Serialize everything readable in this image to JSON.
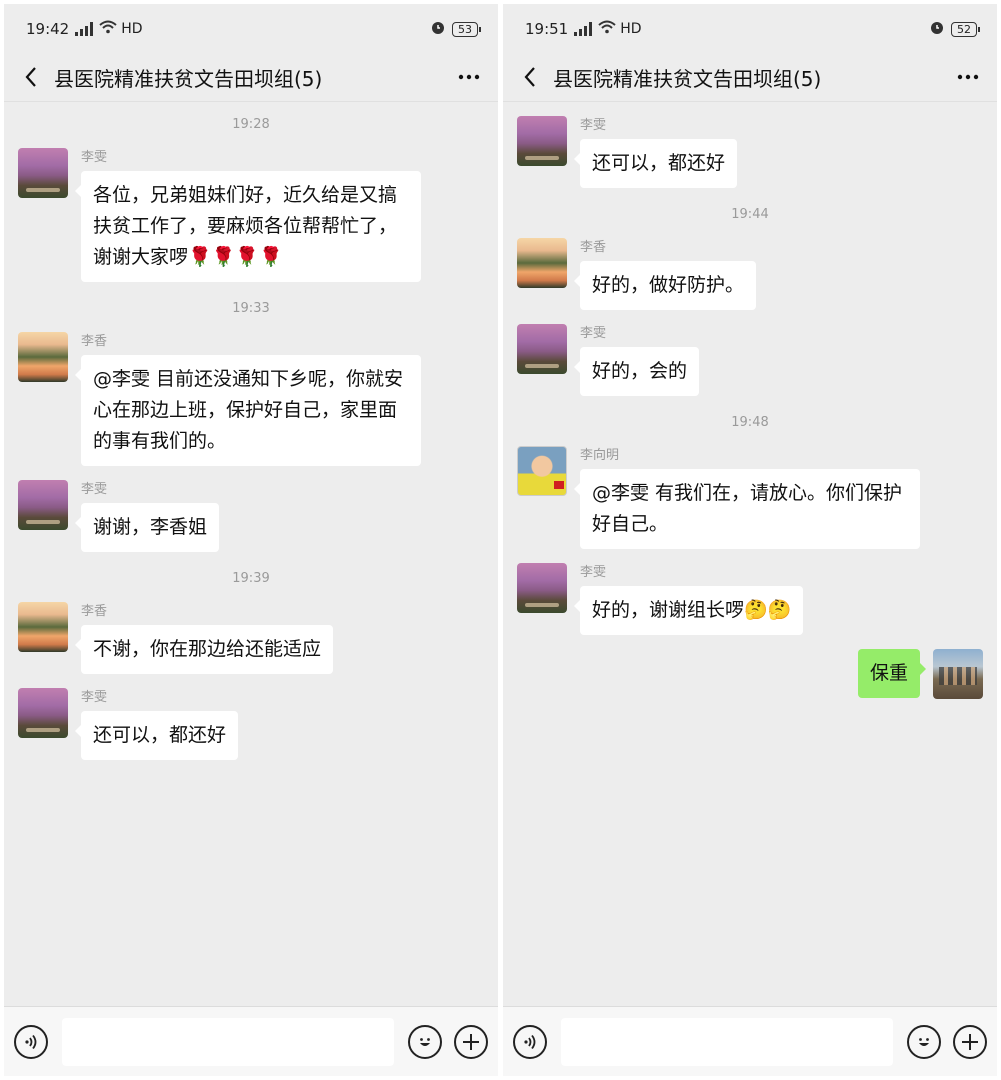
{
  "colors": {
    "bg": "#ededed",
    "bubble_other": "#ffffff",
    "bubble_self": "#95ec69"
  },
  "left": {
    "status": {
      "time": "19:42",
      "hd": "HD",
      "battery": "53"
    },
    "title": "县医院精准扶贫文告田坝组(5)",
    "messages": [
      {
        "type": "time",
        "text": "19:28"
      },
      {
        "type": "msg",
        "sender": "李雯",
        "avatar": "sakura",
        "text": "各位，兄弟姐妹们好，近久给是又搞扶贫工作了，要麻烦各位帮帮忙了，谢谢大家啰🌹🌹🌹🌹"
      },
      {
        "type": "time",
        "text": "19:33"
      },
      {
        "type": "msg",
        "sender": "李香",
        "avatar": "lake",
        "text": "@李雯  目前还没通知下乡呢，你就安心在那边上班，保护好自己，家里面的事有我们的。"
      },
      {
        "type": "msg",
        "sender": "李雯",
        "avatar": "sakura",
        "text": "谢谢，李香姐"
      },
      {
        "type": "time",
        "text": "19:39"
      },
      {
        "type": "msg",
        "sender": "李香",
        "avatar": "lake",
        "text": "不谢，你在那边给还能适应"
      },
      {
        "type": "msg",
        "sender": "李雯",
        "avatar": "sakura",
        "text": "还可以，都还好"
      }
    ]
  },
  "right": {
    "status": {
      "time": "19:51",
      "hd": "HD",
      "battery": "52"
    },
    "title": "县医院精准扶贫文告田坝组(5)",
    "messages": [
      {
        "type": "time",
        "text": "19:33"
      },
      {
        "type": "msg",
        "sender": "李香",
        "avatar": "lake",
        "text": "@李雯  目前还没通知下乡呢，你就安心在那边上班，保护好自己，家里面的事有我们的。"
      },
      {
        "type": "msg",
        "sender": "李雯",
        "avatar": "sakura",
        "text": "谢谢，李香姐"
      },
      {
        "type": "time",
        "text": "19:39"
      },
      {
        "type": "msg",
        "sender": "李香",
        "avatar": "lake",
        "text": "不谢，你在那边给还能适应"
      },
      {
        "type": "msg",
        "sender": "李雯",
        "avatar": "sakura",
        "text": "还可以，都还好"
      },
      {
        "type": "time",
        "text": "19:44"
      },
      {
        "type": "msg",
        "sender": "李香",
        "avatar": "lake",
        "text": "好的，做好防护。"
      },
      {
        "type": "msg",
        "sender": "李雯",
        "avatar": "sakura",
        "text": "好的，会的"
      },
      {
        "type": "time",
        "text": "19:48"
      },
      {
        "type": "msg",
        "sender": "李向明",
        "avatar": "man",
        "text": "@李雯  有我们在，请放心。你们保护好自己。"
      },
      {
        "type": "msg",
        "sender": "李雯",
        "avatar": "sakura",
        "text": "好的，谢谢组长啰🤔🤔"
      },
      {
        "type": "self",
        "avatar": "group",
        "text": "保重"
      }
    ]
  }
}
